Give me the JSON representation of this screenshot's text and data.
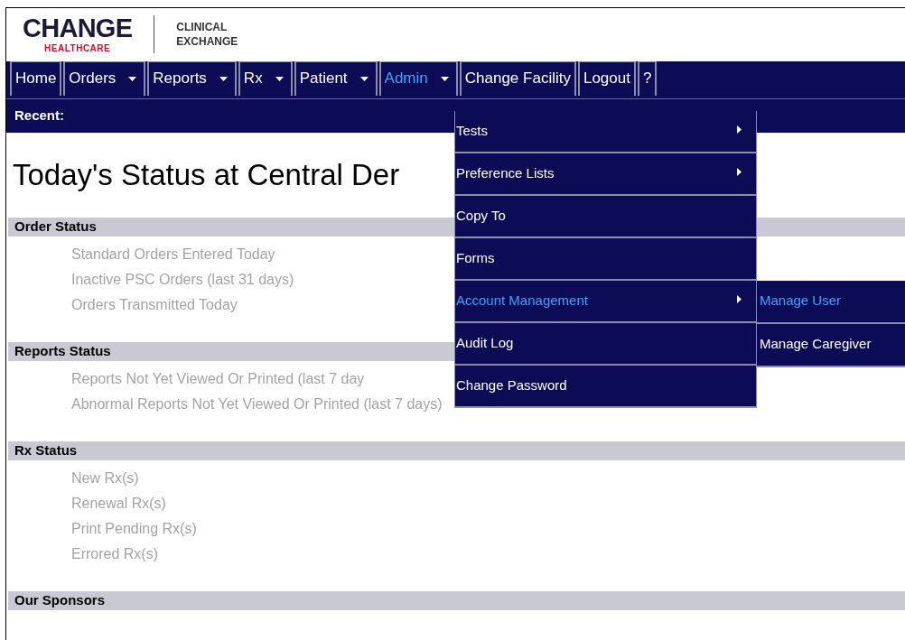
{
  "header": {
    "logo": {
      "word": "CHANGE",
      "sub": "HEALTHCARE"
    },
    "product": [
      "CLINICAL",
      "EXCHANGE"
    ]
  },
  "nav": {
    "tabs": [
      {
        "label": "Home",
        "dropdown": false,
        "selected": false
      },
      {
        "label": "Orders",
        "dropdown": true,
        "selected": false
      },
      {
        "label": "Reports",
        "dropdown": true,
        "selected": false
      },
      {
        "label": "Rx",
        "dropdown": true,
        "selected": false
      },
      {
        "label": "Patient",
        "dropdown": true,
        "selected": false
      },
      {
        "label": "Admin",
        "dropdown": true,
        "selected": true
      },
      {
        "label": "Change Facility",
        "dropdown": false,
        "selected": false
      },
      {
        "label": "Logout",
        "dropdown": false,
        "selected": false
      },
      {
        "label": "?",
        "dropdown": false,
        "selected": false
      }
    ],
    "recent_label": "Recent:"
  },
  "admin_menu": {
    "items": [
      {
        "label": "Tests",
        "submenu": true,
        "highlighted": false
      },
      {
        "label": "Preference Lists",
        "submenu": true,
        "highlighted": false
      },
      {
        "label": "Copy To",
        "submenu": false,
        "highlighted": false
      },
      {
        "label": "Forms",
        "submenu": false,
        "highlighted": false
      },
      {
        "label": "Account Management",
        "submenu": true,
        "highlighted": true
      },
      {
        "label": "Audit Log",
        "submenu": false,
        "highlighted": false
      },
      {
        "label": "Change Password",
        "submenu": false,
        "highlighted": false
      }
    ],
    "submenu": [
      {
        "label": "Manage User",
        "highlighted": true
      },
      {
        "label": "Manage Caregiver",
        "highlighted": false
      }
    ]
  },
  "title": "Today's Status at Central Der",
  "sections": [
    {
      "title": "Order Status",
      "items": [
        "Standard Orders Entered Today",
        "Inactive PSC Orders (last 31 days)",
        "Orders Transmitted Today"
      ]
    },
    {
      "title": "Reports Status",
      "items": [
        "Reports Not Yet Viewed Or Printed (last 7 day",
        "Abnormal Reports Not Yet Viewed Or Printed (last 7 days)"
      ]
    },
    {
      "title": "Rx Status",
      "items": [
        "New Rx(s)",
        "Renewal Rx(s)",
        "Print Pending Rx(s)",
        "Errored Rx(s)"
      ]
    },
    {
      "title": "Our Sponsors"
    }
  ]
}
